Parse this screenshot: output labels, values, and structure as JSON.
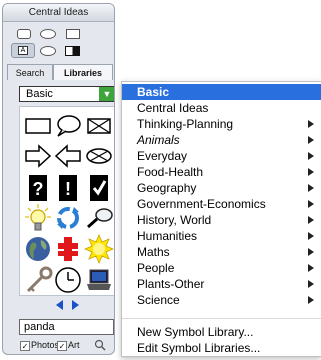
{
  "palette": {
    "title": "Central Ideas",
    "tabs": [
      {
        "label": "Search"
      },
      {
        "label": "Libraries"
      }
    ],
    "library_popup": {
      "value": "Basic"
    },
    "symbols": [
      "rectangle-shape",
      "speech-bubble-shape",
      "crossed-box-shape",
      "right-arrow-shape",
      "left-arrow-shape",
      "crossed-oval-shape",
      "question-mark-sign",
      "exclamation-mark-sign",
      "check-mark-sign",
      "light-bulb",
      "recycle-arrows",
      "magnifying-glass",
      "earth-globe",
      "red-cross",
      "sun",
      "key",
      "clock",
      "laptop"
    ],
    "search": {
      "value": "panda"
    },
    "filters": [
      {
        "label": "Photos",
        "checked": true
      },
      {
        "label": "Art",
        "checked": true
      }
    ]
  },
  "menu": {
    "items": [
      {
        "label": "Basic",
        "selected": true,
        "submenu": false,
        "italic": false
      },
      {
        "label": "Central Ideas",
        "selected": false,
        "submenu": false,
        "italic": false
      },
      {
        "label": "Thinking-Planning",
        "selected": false,
        "submenu": true,
        "italic": false
      },
      {
        "label": "Animals",
        "selected": false,
        "submenu": true,
        "italic": true
      },
      {
        "label": "Everyday",
        "selected": false,
        "submenu": true,
        "italic": false
      },
      {
        "label": "Food-Health",
        "selected": false,
        "submenu": true,
        "italic": false
      },
      {
        "label": "Geography",
        "selected": false,
        "submenu": true,
        "italic": false
      },
      {
        "label": "Government-Economics",
        "selected": false,
        "submenu": true,
        "italic": false
      },
      {
        "label": "History, World",
        "selected": false,
        "submenu": true,
        "italic": false
      },
      {
        "label": "Humanities",
        "selected": false,
        "submenu": true,
        "italic": false
      },
      {
        "label": "Maths",
        "selected": false,
        "submenu": true,
        "italic": false
      },
      {
        "label": "People",
        "selected": false,
        "submenu": true,
        "italic": false
      },
      {
        "label": "Plants-Other",
        "selected": false,
        "submenu": true,
        "italic": false
      },
      {
        "label": "Science",
        "selected": false,
        "submenu": true,
        "italic": false
      }
    ],
    "footer_items": [
      {
        "label": "New Symbol Library..."
      },
      {
        "label": "Edit Symbol Libraries..."
      }
    ]
  }
}
